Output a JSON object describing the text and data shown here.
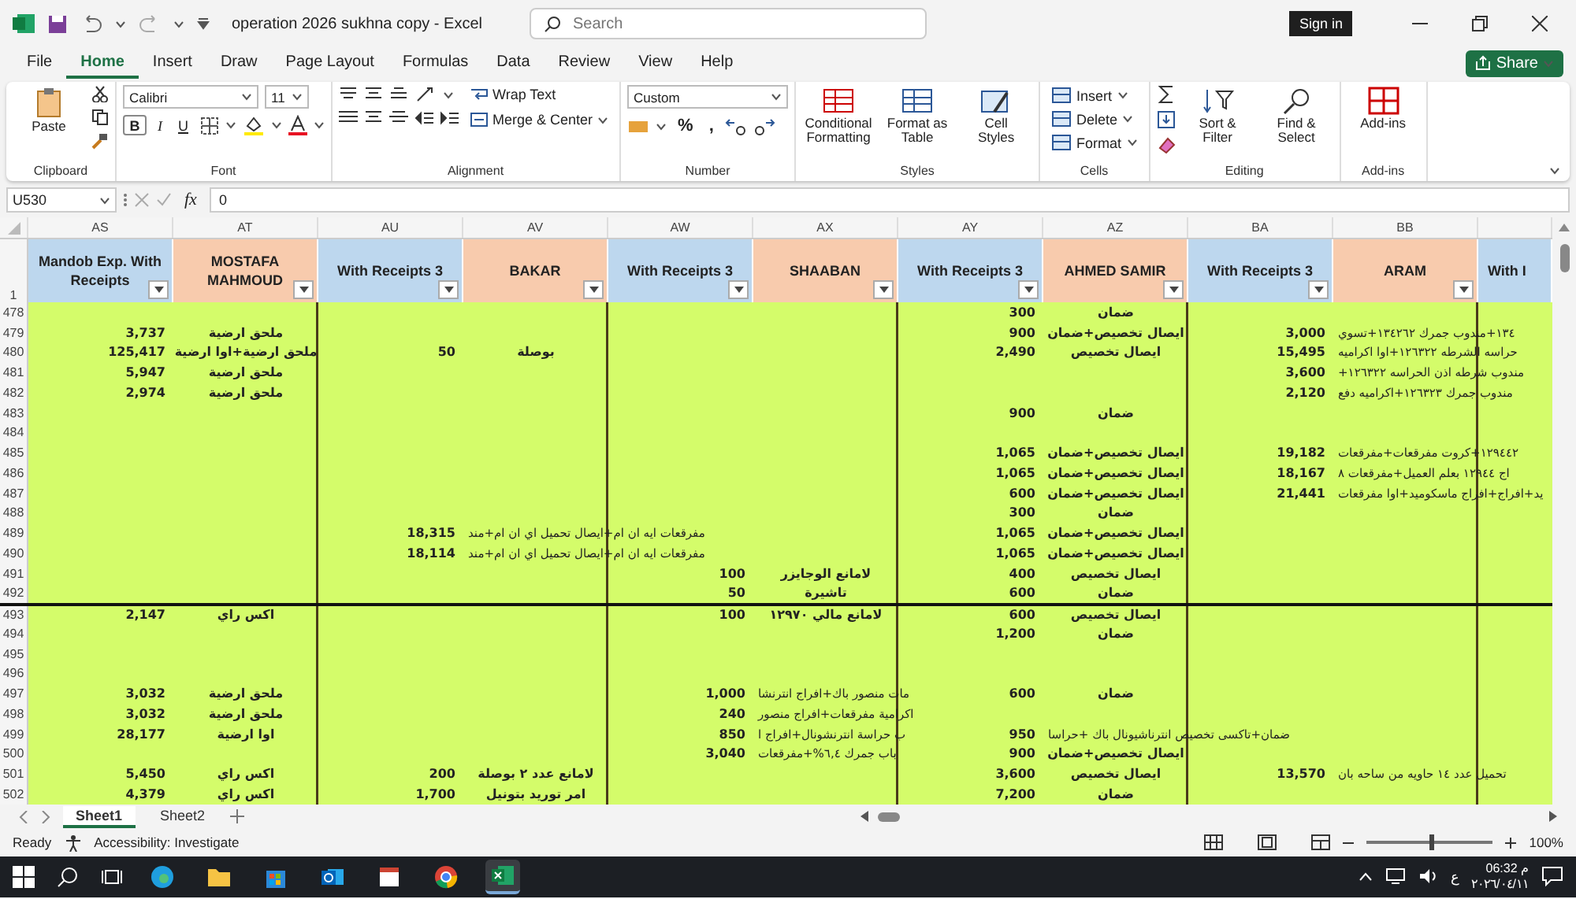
{
  "title_bar": {
    "title": "operation 2026 sukhna copy  -  Excel",
    "search": {
      "placeholder": "Search"
    },
    "sign_in": "Sign in"
  },
  "menu_tabs": [
    {
      "label": "File",
      "selected": false
    },
    {
      "label": "Home",
      "selected": true
    },
    {
      "label": "Insert",
      "selected": false
    },
    {
      "label": "Draw",
      "selected": false
    },
    {
      "label": "Page Layout",
      "selected": false
    },
    {
      "label": "Formulas",
      "selected": false
    },
    {
      "label": "Data",
      "selected": false
    },
    {
      "label": "Review",
      "selected": false
    },
    {
      "label": "View",
      "selected": false
    },
    {
      "label": "Help",
      "selected": false
    }
  ],
  "share": "Share",
  "ribbon": {
    "groups": [
      {
        "label": "Clipboard",
        "kind": "clipboard",
        "buttons": [
          "Paste"
        ]
      },
      {
        "label": "Font",
        "kind": "font",
        "font": "Calibri",
        "size": "11",
        "styles": [
          "B",
          "I",
          "U"
        ]
      },
      {
        "label": "Alignment",
        "kind": "alignment",
        "buttons": [
          "Wrap Text",
          "Merge & Center"
        ]
      },
      {
        "label": "Number",
        "kind": "number",
        "format": "Custom",
        "symbols": [
          "%",
          ","
        ]
      },
      {
        "label": "Styles",
        "kind": "large",
        "buttons": [
          "Conditional Formatting",
          "Format as Table",
          "Cell Styles"
        ]
      },
      {
        "label": "Cells",
        "kind": "list",
        "buttons": [
          "Insert",
          "Delete",
          "Format"
        ]
      },
      {
        "label": "Editing",
        "kind": "editing",
        "buttons": [
          "Sort & Filter",
          "Find & Select"
        ]
      },
      {
        "label": "Add-ins",
        "kind": "large",
        "buttons": [
          "Add-ins"
        ]
      }
    ]
  },
  "formula_bar": {
    "name_box": "U530",
    "fx": "fx",
    "value": "0"
  },
  "sheet": {
    "columns": [
      {
        "letter": "AS",
        "header": "Mandob Exp. With Receipts",
        "color": "#bdd7ee"
      },
      {
        "letter": "AT",
        "header": "MOSTAFA MAHMOUD",
        "color": "#f8cbad"
      },
      {
        "letter": "AU",
        "header": "With Receipts 3",
        "color": "#bdd7ee"
      },
      {
        "letter": "AV",
        "header": "BAKAR",
        "color": "#f8cbad"
      },
      {
        "letter": "AW",
        "header": "With Receipts 3",
        "color": "#bdd7ee"
      },
      {
        "letter": "AX",
        "header": "SHAABAN",
        "color": "#f8cbad"
      },
      {
        "letter": "AY",
        "header": "With Receipts 3",
        "color": "#bdd7ee"
      },
      {
        "letter": "AZ",
        "header": "AHMED SAMIR",
        "color": "#f8cbad"
      },
      {
        "letter": "BA",
        "header": "With Receipts 3",
        "color": "#bdd7ee"
      },
      {
        "letter": "BB",
        "header": "ARAM",
        "color": "#f8cbad"
      },
      {
        "header": "With I",
        "color": "#bdd7ee"
      }
    ],
    "header_row": "1",
    "rows": [
      {
        "number": "478",
        "cells": [
          "",
          "",
          "",
          "",
          "",
          "",
          {
            "value": "300",
            "kind": "number"
          },
          {
            "value": "ضمان",
            "kind": "text"
          },
          "",
          ""
        ]
      },
      {
        "number": "479",
        "cells": [
          {
            "value": "3,737",
            "kind": "number"
          },
          {
            "value": "ملحق ارضية",
            "kind": "text"
          },
          "",
          "",
          "",
          "",
          {
            "value": "900",
            "kind": "number"
          },
          {
            "value": "ايصال تخصيص+ضمان",
            "kind": "text"
          },
          {
            "value": "3,000",
            "kind": "number"
          },
          {
            "value": "١٣٤+مندوب جمرك ١٣٤٢٦٢+تسوي",
            "kind": "spill"
          }
        ]
      },
      {
        "number": "480",
        "cells": [
          {
            "value": "125,417",
            "kind": "number"
          },
          {
            "value": "ملحق ارضية+اوا ارضية",
            "kind": "text"
          },
          {
            "value": "50",
            "kind": "number"
          },
          {
            "value": "بوصلة",
            "kind": "text"
          },
          "",
          "",
          {
            "value": "2,490",
            "kind": "number"
          },
          {
            "value": "ايصال تخصيص",
            "kind": "text"
          },
          {
            "value": "15,495",
            "kind": "number"
          },
          {
            "value": "حراسه الشرطه ١٢٦٣٢٢+اوا اكراميه",
            "kind": "spill"
          }
        ]
      },
      {
        "number": "481",
        "cells": [
          {
            "value": "5,947",
            "kind": "number"
          },
          {
            "value": "ملحق ارضية",
            "kind": "text"
          },
          "",
          "",
          "",
          "",
          "",
          "",
          {
            "value": "3,600",
            "kind": "number"
          },
          {
            "value": "مندوب شرطه اذن الحراسه ١٢٦٣٢٢+",
            "kind": "spill"
          }
        ]
      },
      {
        "number": "482",
        "cells": [
          {
            "value": "2,974",
            "kind": "number"
          },
          {
            "value": "ملحق ارضية",
            "kind": "text"
          },
          "",
          "",
          "",
          "",
          "",
          "",
          {
            "value": "2,120",
            "kind": "number"
          },
          {
            "value": "مندوب جمرك ١٢٦٣٢٣+اكراميه دفع",
            "kind": "spill"
          }
        ]
      },
      {
        "number": "483",
        "cells": [
          "",
          "",
          "",
          "",
          "",
          "",
          {
            "value": "900",
            "kind": "number"
          },
          {
            "value": "ضمان",
            "kind": "text"
          },
          "",
          ""
        ]
      },
      {
        "number": "484",
        "cells": []
      },
      {
        "number": "485",
        "cells": [
          "",
          "",
          "",
          "",
          "",
          "",
          {
            "value": "1,065",
            "kind": "number"
          },
          {
            "value": "ايصال تخصيص+ضمان",
            "kind": "text"
          },
          {
            "value": "19,182",
            "kind": "number"
          },
          {
            "value": "١٢٩٤٤٢+كروت مفرقعات+مفرقعات",
            "kind": "spill"
          }
        ]
      },
      {
        "number": "486",
        "cells": [
          "",
          "",
          "",
          "",
          "",
          "",
          {
            "value": "1,065",
            "kind": "number"
          },
          {
            "value": "ايصال تخصيص+ضمان",
            "kind": "text"
          },
          {
            "value": "18,167",
            "kind": "number"
          },
          {
            "value": "اج ١٢٩٤٤ بعلم العميل+مفرقعات ٨",
            "kind": "spill"
          }
        ]
      },
      {
        "number": "487",
        "cells": [
          "",
          "",
          "",
          "",
          "",
          "",
          {
            "value": "600",
            "kind": "number"
          },
          {
            "value": "ايصال تخصيص+ضمان",
            "kind": "text"
          },
          {
            "value": "21,441",
            "kind": "number"
          },
          {
            "value": "يد+افراج+افراج ماسكوميد+اوا مفرقعات",
            "kind": "spill"
          }
        ]
      },
      {
        "number": "488",
        "cells": [
          "",
          "",
          "",
          "",
          "",
          "",
          {
            "value": "300",
            "kind": "number"
          },
          {
            "value": "ضمان",
            "kind": "text"
          },
          "",
          ""
        ]
      },
      {
        "number": "489",
        "cells": [
          "",
          "",
          {
            "value": "18,315",
            "kind": "number"
          },
          {
            "value": "مفرقعات ايه ان ام+ايصال تحميل اي ان ام+مند",
            "kind": "spill"
          },
          "",
          "",
          {
            "value": "1,065",
            "kind": "number"
          },
          {
            "value": "ايصال تخصيص+ضمان",
            "kind": "text"
          },
          "",
          ""
        ]
      },
      {
        "number": "490",
        "cells": [
          "",
          "",
          {
            "value": "18,114",
            "kind": "number"
          },
          {
            "value": "مفرقعات ايه ان ام+ايصال تحميل اي ان ام+مند",
            "kind": "spill"
          },
          "",
          "",
          {
            "value": "1,065",
            "kind": "number"
          },
          {
            "value": "ايصال تخصيص+ضمان",
            "kind": "text"
          },
          "",
          ""
        ]
      },
      {
        "number": "491",
        "cells": [
          "",
          "",
          "",
          "",
          {
            "value": "100",
            "kind": "number"
          },
          {
            "value": "لامانع الوجايزر",
            "kind": "text"
          },
          {
            "value": "400",
            "kind": "number"
          },
          {
            "value": "ايصال تخصيص",
            "kind": "text"
          },
          "",
          ""
        ]
      },
      {
        "number": "492",
        "cells": [
          "",
          "",
          "",
          "",
          {
            "value": "50",
            "kind": "number"
          },
          {
            "value": "تاشيرة",
            "kind": "text"
          },
          {
            "value": "600",
            "kind": "number"
          },
          {
            "value": "ضمان",
            "kind": "text"
          },
          "",
          ""
        ]
      },
      {
        "number": "493",
        "divider_above": true,
        "cells": [
          {
            "value": "2,147",
            "kind": "number"
          },
          {
            "value": "اكس راي",
            "kind": "text"
          },
          "",
          "",
          {
            "value": "100",
            "kind": "number"
          },
          {
            "value": "لامانع مالي ١٢٩٧٠",
            "kind": "text"
          },
          {
            "value": "600",
            "kind": "number"
          },
          {
            "value": "ايصال تخصيص",
            "kind": "text"
          },
          "",
          ""
        ]
      },
      {
        "number": "494",
        "cells": [
          "",
          "",
          "",
          "",
          "",
          "",
          {
            "value": "1,200",
            "kind": "number"
          },
          {
            "value": "ضمان",
            "kind": "text"
          },
          "",
          ""
        ]
      },
      {
        "number": "495",
        "cells": []
      },
      {
        "number": "496",
        "cells": []
      },
      {
        "number": "497",
        "cells": [
          {
            "value": "3,032",
            "kind": "number"
          },
          {
            "value": "ملحق ارضية",
            "kind": "text"
          },
          "",
          "",
          {
            "value": "1,000",
            "kind": "number"
          },
          {
            "value": "مات منصور باك+افراج انترنشا",
            "kind": "spill"
          },
          {
            "value": "600",
            "kind": "number"
          },
          {
            "value": "ضمان",
            "kind": "text"
          },
          "",
          ""
        ]
      },
      {
        "number": "498",
        "cells": [
          {
            "value": "3,032",
            "kind": "number"
          },
          {
            "value": "ملحق ارضية",
            "kind": "text"
          },
          "",
          "",
          {
            "value": "240",
            "kind": "number"
          },
          {
            "value": "اكرامية مفرقعات+افراج منصور",
            "kind": "spill"
          },
          "",
          "",
          "",
          ""
        ]
      },
      {
        "number": "499",
        "cells": [
          {
            "value": "28,177",
            "kind": "number"
          },
          {
            "value": "اوا ارضية",
            "kind": "text"
          },
          "",
          "",
          {
            "value": "850",
            "kind": "number"
          },
          {
            "value": "ب حراسة انترنشونال+افراج ا",
            "kind": "spill"
          },
          {
            "value": "950",
            "kind": "number"
          },
          {
            "value": "ضمان+تاكسى تخصيص انترناشيونال باك +حراسا",
            "kind": "spill"
          },
          "",
          ""
        ]
      },
      {
        "number": "500",
        "cells": [
          "",
          "",
          "",
          "",
          {
            "value": "3,040",
            "kind": "number"
          },
          {
            "value": "باب جمرك ٦,٤%+مفرقعات",
            "kind": "spill"
          },
          {
            "value": "900",
            "kind": "number"
          },
          {
            "value": "ايصال تخصيص+ضمان",
            "kind": "text"
          },
          "",
          ""
        ]
      },
      {
        "number": "501",
        "cells": [
          {
            "value": "5,450",
            "kind": "number"
          },
          {
            "value": "اكس راي",
            "kind": "text"
          },
          {
            "value": "200",
            "kind": "number"
          },
          {
            "value": "لامانع عدد ٢ بوصلة",
            "kind": "text"
          },
          "",
          "",
          {
            "value": "3,600",
            "kind": "number"
          },
          {
            "value": "ايصال تخصيص",
            "kind": "text"
          },
          {
            "value": "13,570",
            "kind": "number"
          },
          {
            "value": "تحميل عدد ١٤ حاويه من ساحه بان",
            "kind": "spill"
          }
        ]
      },
      {
        "number": "502",
        "cells": [
          {
            "value": "4,379",
            "kind": "number"
          },
          {
            "value": "اكس راي",
            "kind": "text"
          },
          {
            "value": "1,700",
            "kind": "number"
          },
          {
            "value": "امر توريد بتونيل",
            "kind": "text"
          },
          "",
          "",
          {
            "value": "7,200",
            "kind": "number"
          },
          {
            "value": "ضمان",
            "kind": "text"
          },
          "",
          ""
        ]
      }
    ]
  },
  "sheet_tabs": [
    {
      "label": "Sheet1",
      "selected": true
    },
    {
      "label": "Sheet2",
      "selected": false
    }
  ],
  "status_bar": {
    "ready": "Ready",
    "accessibility": "Accessibility: Investigate",
    "zoom": {
      "level": 0.5,
      "reading": "100%"
    }
  },
  "taskbar": {
    "apps": [
      {
        "kind": "edge",
        "selected": false
      },
      {
        "kind": "folder",
        "selected": false
      },
      {
        "kind": "store",
        "selected": false
      },
      {
        "kind": "outlook",
        "selected": false
      },
      {
        "kind": "calendar",
        "selected": false
      },
      {
        "kind": "chrome",
        "selected": false
      },
      {
        "kind": "excel",
        "selected": true
      }
    ],
    "language": "ع",
    "time": "06:32 م",
    "date": "٢٠٢٦/٠٤/١١"
  }
}
